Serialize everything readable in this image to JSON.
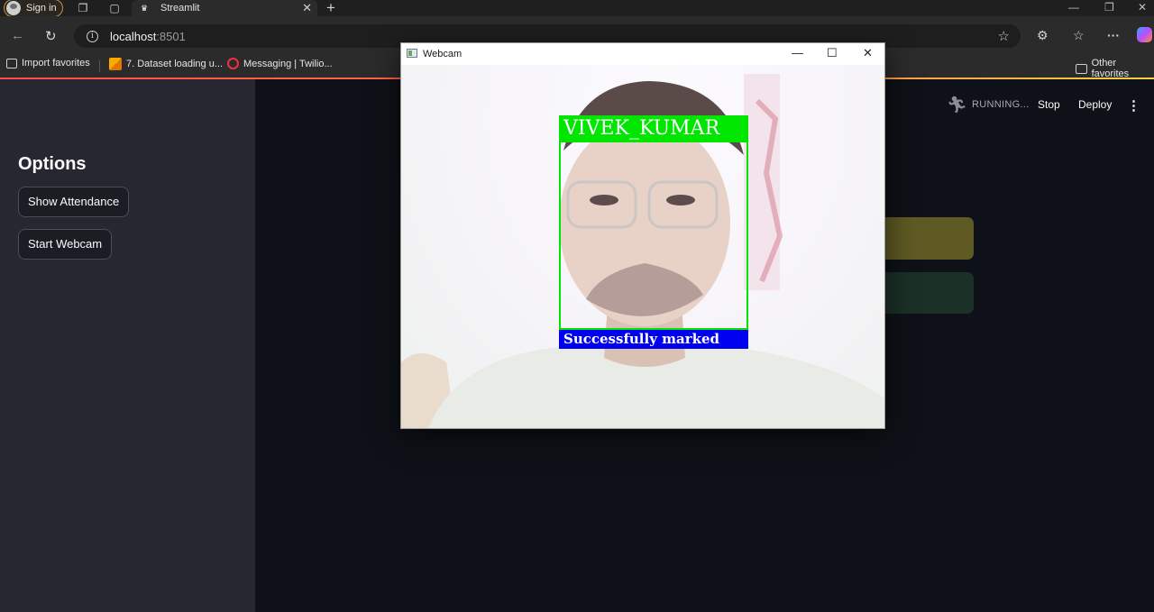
{
  "browser": {
    "signin_label": "Sign in",
    "tab_title": "Streamlit",
    "url_host": "localhost",
    "url_port": ":8501",
    "bookmarks": [
      "Import favorites",
      "7. Dataset loading u...",
      "Messaging | Twilio..."
    ],
    "other_favorites": "Other favorites"
  },
  "app": {
    "sidebar_title": "Options",
    "buttons": [
      "Show Attendance",
      "Start Webcam"
    ],
    "status": "RUNNING...",
    "stop_label": "Stop",
    "deploy_label": "Deploy"
  },
  "webcam": {
    "window_title": "Webcam",
    "person_label": "VIVEK_KUMAR",
    "status_label": "Successfully marked"
  },
  "colors": {
    "accent": "#ff4b4b",
    "sidebar_bg": "#262730",
    "main_bg": "#0e1117",
    "face_box": "#00e600",
    "status_box": "#0000f0"
  }
}
